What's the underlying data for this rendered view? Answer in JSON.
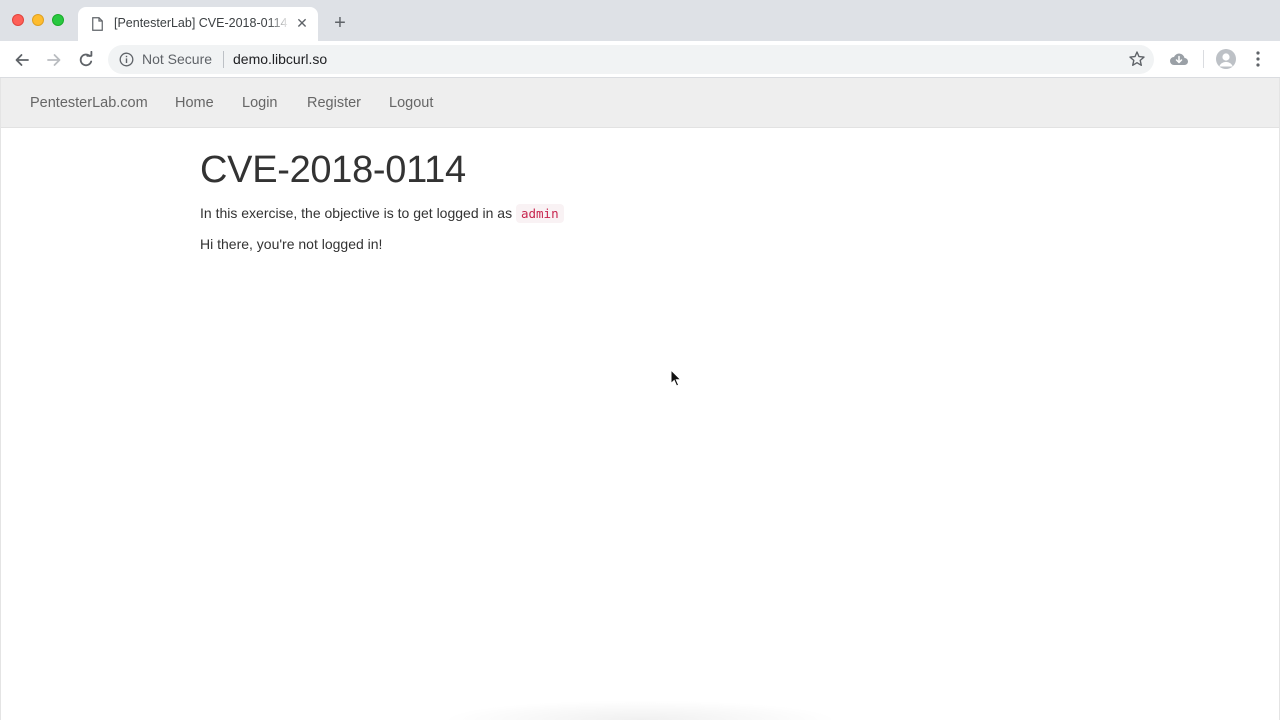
{
  "browser": {
    "tab": {
      "title": "[PentesterLab] CVE-2018-0114",
      "close_glyph": "✕"
    },
    "new_tab_glyph": "+",
    "omnibox": {
      "security_label": "Not Secure",
      "url": "demo.libcurl.so"
    }
  },
  "colors": {
    "link_code": "#c7254e",
    "navbar_bg": "#eeeeee",
    "text": "#333333"
  },
  "navbar": {
    "brand": "PentesterLab.com",
    "links": [
      "Home",
      "Login",
      "Register",
      "Logout"
    ]
  },
  "main": {
    "title": "CVE-2018-0114",
    "objective_text": "In this exercise, the objective is to get logged in as",
    "objective_code": "admin",
    "status": "Hi there, you're not logged in!"
  }
}
